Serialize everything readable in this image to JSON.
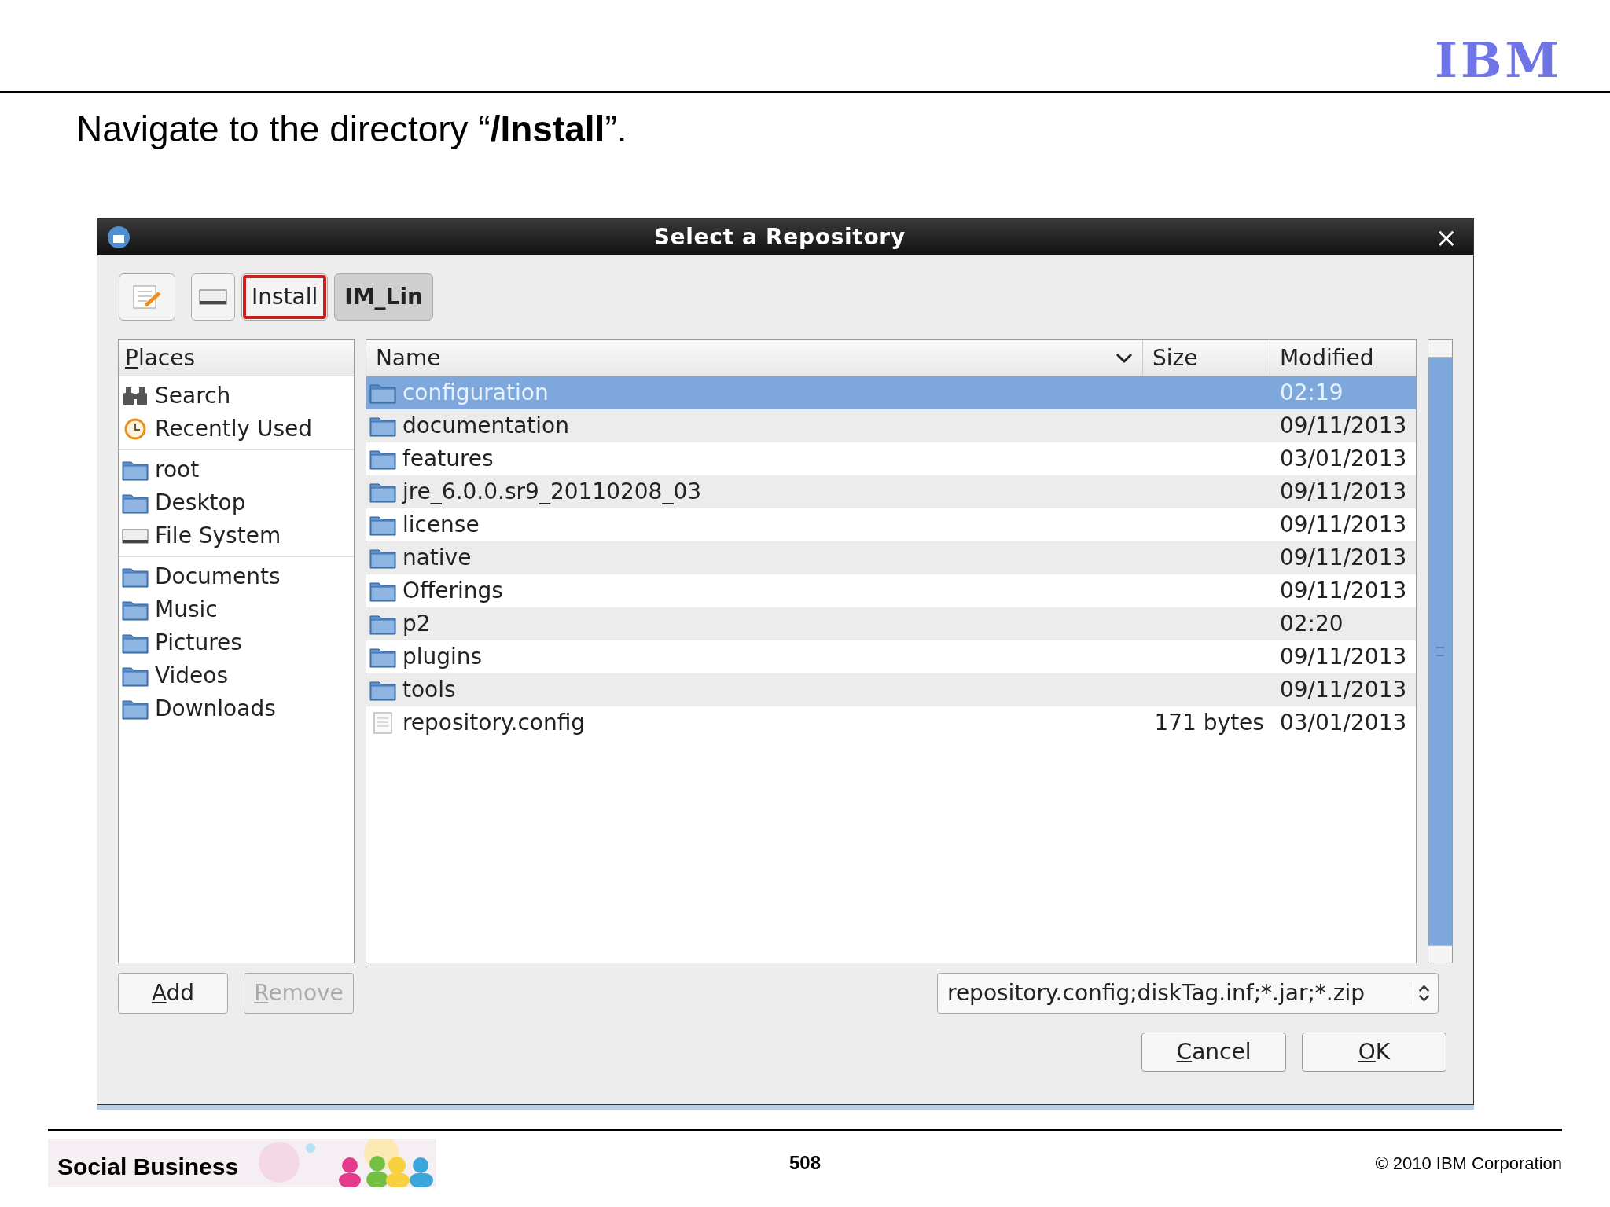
{
  "slide": {
    "logo": "IBM",
    "title": "Navigate to the directory “**/Install**”."
  },
  "dialog": {
    "title": "Select a Repository",
    "close": "×",
    "path_buttons": [
      {
        "kind": "edit"
      },
      {
        "kind": "drive"
      },
      {
        "kind": "text",
        "label": "Install",
        "selected": false,
        "highlighted": true
      },
      {
        "kind": "text",
        "label": "IM_Lin",
        "selected": true,
        "highlighted": false
      }
    ],
    "places": {
      "header": "Places",
      "groups": [
        [
          {
            "label": "Search",
            "kind": "search"
          },
          {
            "label": "Recently Used",
            "kind": "recent"
          }
        ],
        [
          {
            "label": "root",
            "kind": "folder"
          },
          {
            "label": "Desktop",
            "kind": "folder"
          },
          {
            "label": "File System",
            "kind": "drive"
          }
        ],
        [
          {
            "label": "Documents",
            "kind": "folder"
          },
          {
            "label": "Music",
            "kind": "folder"
          },
          {
            "label": "Pictures",
            "kind": "folder"
          },
          {
            "label": "Videos",
            "kind": "folder"
          },
          {
            "label": "Downloads",
            "kind": "folder"
          }
        ]
      ]
    },
    "columns": [
      "Name",
      "Size",
      "Modified"
    ],
    "rows": [
      {
        "name": "configuration",
        "size": "",
        "modified": "02:19",
        "kind": "folder",
        "selected": true
      },
      {
        "name": "documentation",
        "size": "",
        "modified": "09/11/2013",
        "kind": "folder",
        "selected": false
      },
      {
        "name": "features",
        "size": "",
        "modified": "03/01/2013",
        "kind": "folder",
        "selected": false
      },
      {
        "name": "jre_6.0.0.sr9_20110208_03",
        "size": "",
        "modified": "09/11/2013",
        "kind": "folder",
        "selected": false
      },
      {
        "name": "license",
        "size": "",
        "modified": "09/11/2013",
        "kind": "folder",
        "selected": false
      },
      {
        "name": "native",
        "size": "",
        "modified": "09/11/2013",
        "kind": "folder",
        "selected": false
      },
      {
        "name": "Offerings",
        "size": "",
        "modified": "09/11/2013",
        "kind": "folder",
        "selected": false
      },
      {
        "name": "p2",
        "size": "",
        "modified": "02:20",
        "kind": "folder",
        "selected": false
      },
      {
        "name": "plugins",
        "size": "",
        "modified": "09/11/2013",
        "kind": "folder",
        "selected": false
      },
      {
        "name": "tools",
        "size": "",
        "modified": "09/11/2013",
        "kind": "folder",
        "selected": false
      },
      {
        "name": "repository.config",
        "size": "171 bytes",
        "modified": "03/01/2013",
        "kind": "file",
        "selected": false
      }
    ],
    "side_buttons": [
      {
        "label": "Add",
        "disabled": false
      },
      {
        "label": "Remove",
        "disabled": true
      }
    ],
    "filter": "repository.config;diskTag.inf;*.jar;*.zip",
    "actions": [
      "Cancel",
      "OK"
    ]
  },
  "footer": {
    "brand": "Social Business",
    "page": "508",
    "copyright": "© 2010 IBM Corporation"
  }
}
